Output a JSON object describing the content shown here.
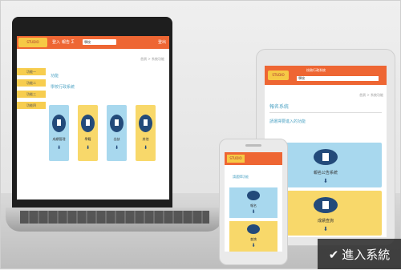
{
  "colors": {
    "header": "#ee6633",
    "nav": "#f7cd4f",
    "card_blue": "#a8d8ee",
    "card_yellow": "#f8d86a",
    "icon_dark": "#234a7a",
    "accent_text": "#4ea3c4"
  },
  "laptop": {
    "logo": "STUDIO",
    "header_links": [
      "登入",
      "報告",
      "∑"
    ],
    "select": "學校",
    "header_right": "登出",
    "breadcrumb": "首頁 > 系統功能",
    "nav": [
      "功能一",
      "功能二",
      "功能三",
      "功能四"
    ],
    "section_title": "功能",
    "section_sub": "學校行政系統",
    "cards": [
      {
        "label": "成績管理",
        "color": "blue"
      },
      {
        "label": "學籍",
        "color": "yellow"
      },
      {
        "label": "出缺",
        "color": "blue"
      },
      {
        "label": "其他",
        "color": "yellow"
      }
    ]
  },
  "tablet": {
    "logo": "STUDIO",
    "title": "校務行政系統",
    "select": "學校",
    "breadcrumb": "首頁 > 系統功能",
    "section_title": "報名系統",
    "section_sub": "請選擇要進入的功能",
    "cards": [
      {
        "label": "報名公告系統",
        "color": "blue"
      },
      {
        "label": "成績查詢",
        "color": "yellow"
      }
    ]
  },
  "phone": {
    "logo": "STUDIO",
    "text": "請選擇功能",
    "cards": [
      {
        "label": "報名",
        "color": "blue"
      },
      {
        "label": "查詢",
        "color": "yellow"
      }
    ]
  },
  "enter_button": {
    "icon": "check-icon",
    "label": "進入系統"
  }
}
